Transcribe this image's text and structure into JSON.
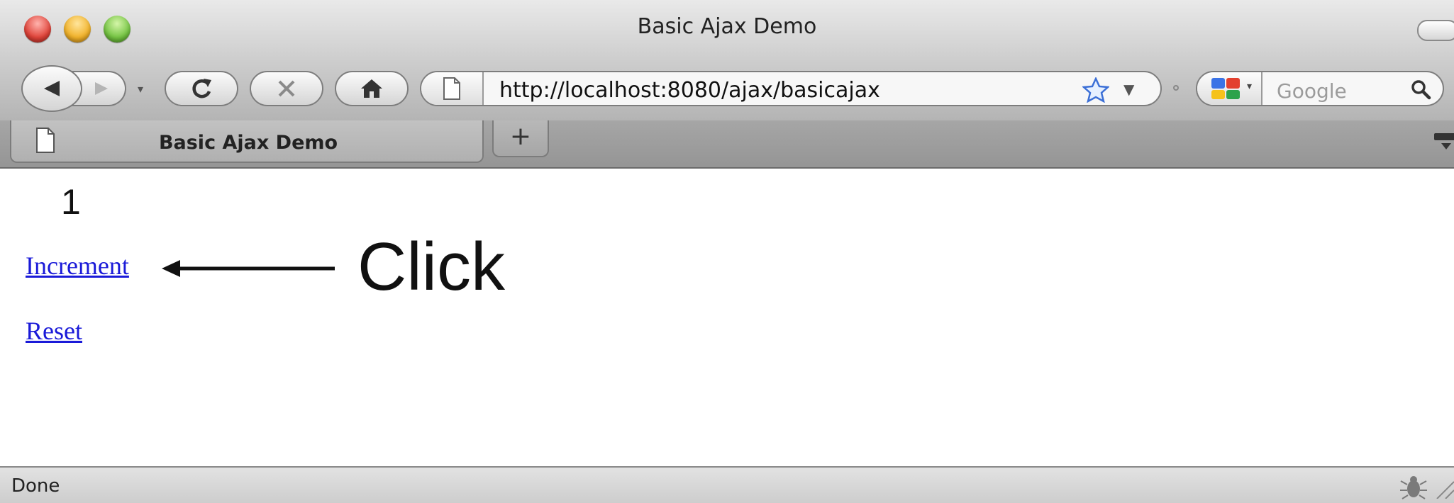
{
  "window": {
    "title": "Basic Ajax Demo"
  },
  "toolbar": {
    "url": "http://localhost:8080/ajax/basicajax",
    "search_placeholder": "Google",
    "history_dropdown_glyph": "▾",
    "url_dropdown_glyph": "▼",
    "search_engine_glyph": "▾"
  },
  "tabs": {
    "active_title": "Basic Ajax Demo",
    "new_tab_label": "+"
  },
  "page": {
    "counter": "1",
    "increment_label": "Increment",
    "reset_label": "Reset",
    "annotation": "Click"
  },
  "status": {
    "text": "Done"
  },
  "icons": {
    "back": "back-arrow-icon",
    "forward": "forward-arrow-icon",
    "reload": "reload-icon",
    "stop": "stop-icon",
    "home": "home-icon",
    "page": "page-icon",
    "bookmark": "star-icon",
    "search_engine": "google-logo-icon",
    "search": "search-icon",
    "status": "firebug-icon"
  },
  "colors": {
    "link": "#1a1ad8",
    "close": "#e0443a",
    "minimize": "#f1b22a",
    "maximize": "#75c443",
    "google_blue": "#3b73e6",
    "google_red": "#e3402f",
    "google_yellow": "#f5c21b",
    "google_green": "#2da24b"
  }
}
